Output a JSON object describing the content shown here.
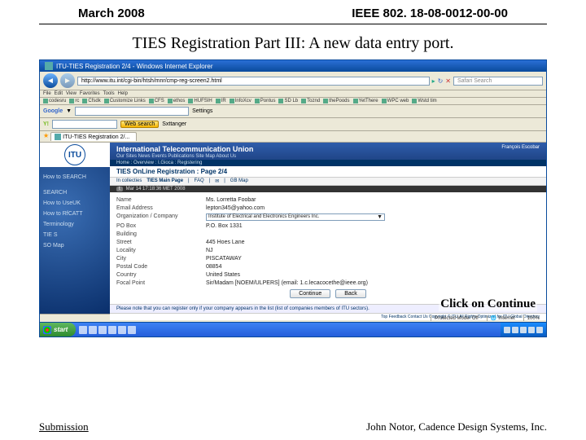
{
  "slide": {
    "date": "March 2008",
    "doc_id": "IEEE 802. 18-08-0012-00-00",
    "title": "TIES Registration Part III: A new data entry port.",
    "annotation": "Click on Continue",
    "footer_left": "Submission",
    "footer_right": "John Notor, Cadence Design Systems, Inc."
  },
  "browser": {
    "title": "ITU-TIES Registration 2/4 - Windows Internet Explorer",
    "url": "http://www.itu.int/cgi-bin/htsh/mnr/cmp-reg-screen2.html",
    "search_placeholder": "Safari Search",
    "menu_file": "File",
    "menu_edit": "Edit",
    "menu_view": "View",
    "menu_favorites": "Favorites",
    "menu_tools": "Tools",
    "menu_help": "Help",
    "bookmarks": [
      "codesru",
      "rc",
      "Cfsdk",
      "Customize Links",
      "CFS",
      "ethos",
      "HUFSIH",
      "IR",
      "InfoXcv",
      "Pontus",
      "SD Lb",
      "Toznd",
      "thePoods",
      "YetThere",
      "WPC web",
      "Wstd tim"
    ],
    "google_label": "Google",
    "google_buttons": [
      "Settings"
    ],
    "yahoo_label": "Y!",
    "yahoo_search_btn": "Web search",
    "yahoo_settings": "Sxttanger",
    "tab_label": "ITU-TIES Registration 2/...",
    "status_protected": "Protected Mode: Off",
    "status_zone": "Internet",
    "status_zoom": "100%"
  },
  "itu": {
    "org_name": "International Telecommunication Union",
    "nav": "Our Sites   News   Events   Publications   Site Map   About Us",
    "user": "François Escobar",
    "breadcrumb": "Home : Overview : I.Gioca : Registering",
    "page_title": "TIES OnLine Registration : Page 2/4",
    "tabs": [
      "In collecties",
      "TIES Main Page",
      "FAQ",
      "✉",
      "GB Map"
    ],
    "timestamp_label": "t",
    "timestamp": "Mar 14 17:18:36 MET 2008",
    "form": {
      "name_label": "Name",
      "name_val": "Ms. Lorretta Foobar",
      "email_label": "Email Address",
      "email_val": "lepton345@yahoo.com",
      "org_label": "Organization / Company",
      "org_val": "Institute of Electrical and Electronics Engineers Inc.",
      "pobox_label": "PO Box",
      "pobox_val": "P.O. Box 1331",
      "building_label": "Building",
      "building_val": "",
      "street_label": "Street",
      "street_val": "445 Hoes Lane",
      "locality_label": "Locality",
      "locality_val": "NJ",
      "city_label": "City",
      "city_val": "PISCATAWAY",
      "postal_label": "Postal Code",
      "postal_val": "08854",
      "country_label": "Country",
      "country_val": "United States",
      "focal_label": "Focal Point",
      "focal_val": "Sir/Madam [NOEM/ULPERS] (email: 1.c.lecacocethe@ieee.org)"
    },
    "btn_continue": "Continue",
    "btn_back": "Back",
    "note": "Please note that you can register only if your company appears in the list (list of companies members of ITU sectors).",
    "footer": "Top   Feedback   Contact Us   Copyright © ITU All Rights   Optimized for ITU Global Directory"
  },
  "sidebar": {
    "links": [
      "How to SEARCH",
      "SEARCH",
      "How to UseUK",
      "How to RfCATT",
      "Terminology",
      "TIE S",
      "SO Map"
    ]
  },
  "taskbar": {
    "start": "start"
  }
}
